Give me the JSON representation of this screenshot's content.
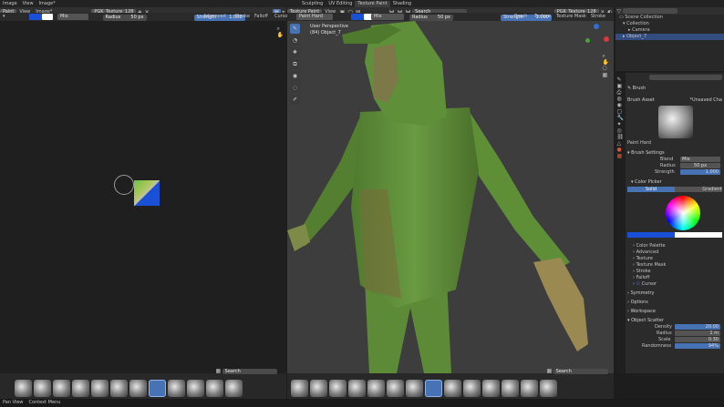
{
  "topbar": {
    "menu": [
      "Image",
      "View",
      "Image*"
    ],
    "tabs": [
      "Sculpting",
      "UV Editing",
      "Texture Paint",
      "Shading"
    ]
  },
  "image_editor": {
    "header": {
      "mode": "Paint",
      "view": "View",
      "image_menu": "Image*",
      "image_name": "PGK_Texture_128"
    },
    "tool": {
      "blend": "Mix",
      "radius_label": "Radius",
      "radius_value": "50 px",
      "strength_label": "Strength",
      "strength_value": "1.000",
      "advanced": "Advanced",
      "stroke": "Stroke",
      "falloff": "Falloff",
      "cursor": "Curso"
    },
    "search_placeholder": "Search"
  },
  "viewport": {
    "header": {
      "mode": "Texture Paint",
      "view": "View",
      "image_name": "PGK_Texture_128",
      "texture_mask": "Texture Mask",
      "stroke": "Stroke",
      "brush_name": "Paint Hard"
    },
    "tool": {
      "blend": "Mix",
      "radius_label": "Radius",
      "radius_value": "50 px",
      "strength_label": "Strength",
      "strength_value": "1.000",
      "brush": "Brush",
      "texture": "Texture",
      "texture_mask": "Texture Mask",
      "stroke": "Stroke"
    },
    "overlay": {
      "line1": "User Perspective",
      "line2": "(84) Object_7"
    },
    "search_placeholder": "Search"
  },
  "outliner": {
    "title": "Scene Collection",
    "items": [
      "Collection",
      "Camera",
      "Object_7"
    ]
  },
  "properties": {
    "search_placeholder": "",
    "brush_section": "Brush",
    "brush_asset": "Brush Asset",
    "brush_asset_name": "*Unsaved Cha",
    "brush_name": "Paint Hard",
    "brush_settings": "Brush Settings",
    "blend_label": "Blend",
    "blend_value": "Mix",
    "radius_label": "Radius",
    "radius_value": "50 px",
    "strength_label": "Strength",
    "strength_value": "1.000",
    "color_picker": "Color Picker",
    "color_tabs": [
      "Solid",
      "Gradient"
    ],
    "subpanels": [
      "Color Palette",
      "Advanced",
      "Texture",
      "Texture Mask",
      "Stroke",
      "Falloff",
      "Cursor"
    ],
    "sections": [
      "Symmetry",
      "Options",
      "Workspace",
      "Object Scatter"
    ],
    "scatter": [
      {
        "label": "Density",
        "value": "20.00"
      },
      {
        "label": "Radius",
        "value": "1 m"
      },
      {
        "label": "Scale",
        "value": "0.30"
      },
      {
        "label": "Randomness",
        "value": "94%"
      }
    ]
  },
  "status": {
    "left": "Pan View",
    "mid": "Context Menu"
  },
  "colors": {
    "accent": "#4772b3",
    "primary_swatch": "#1a4fd8",
    "secondary_swatch": "#ffffff",
    "mesh": "#5c8a3a"
  }
}
